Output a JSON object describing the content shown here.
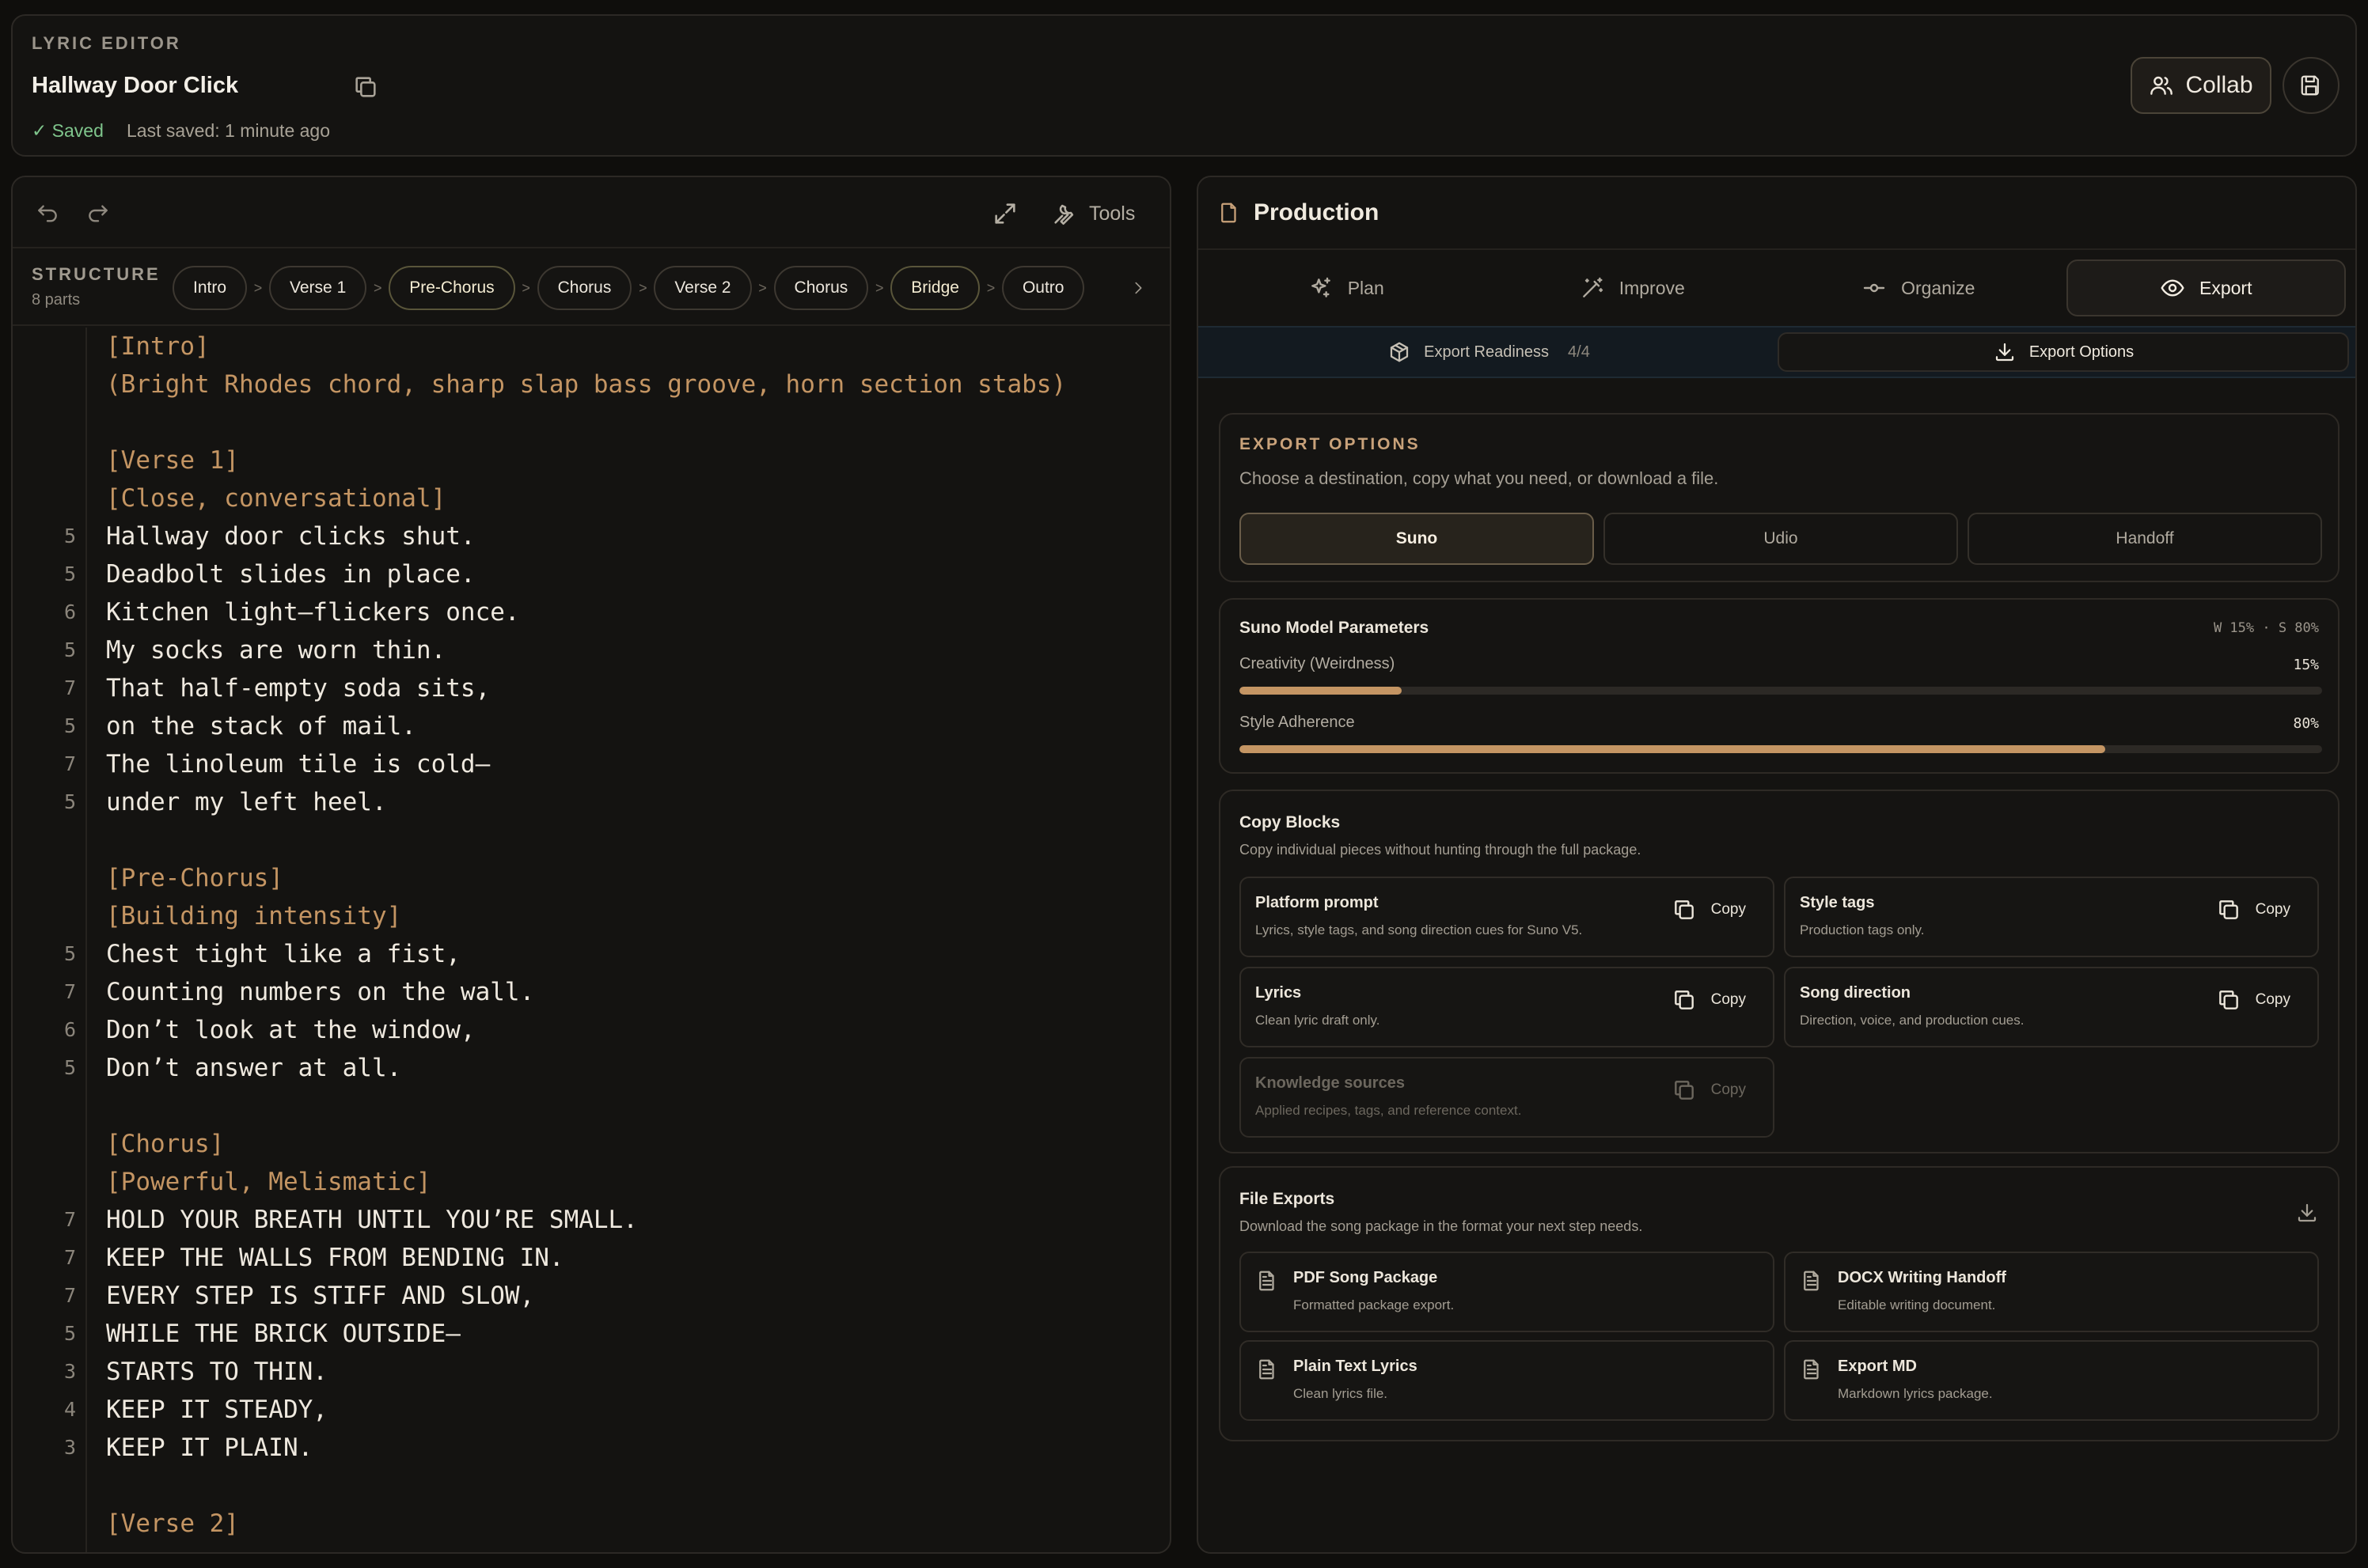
{
  "header": {
    "kicker": "LYRIC EDITOR",
    "title": "Hallway Door Click",
    "saved": "✓ Saved",
    "last_saved": "Last saved: 1 minute ago",
    "collab_label": "Collab"
  },
  "editor": {
    "tools_label": "Tools",
    "structure_label": "STRUCTURE",
    "structure_parts": "8 parts",
    "structure_chips": [
      "Intro",
      "Verse 1",
      "Pre-Chorus",
      "Chorus",
      "Verse 2",
      "Chorus",
      "Bridge",
      "Outro"
    ],
    "lines": [
      {
        "n": "",
        "text": "[Intro]",
        "tag": true
      },
      {
        "n": "",
        "text": "(Bright Rhodes chord, sharp slap bass groove, horn section stabs)",
        "tag": true
      },
      {
        "n": "",
        "text": "",
        "tag": false
      },
      {
        "n": "",
        "text": "[Verse 1]",
        "tag": true
      },
      {
        "n": "",
        "text": "[Close, conversational]",
        "tag": true
      },
      {
        "n": "5",
        "text": "Hallway door clicks shut.",
        "tag": false
      },
      {
        "n": "5",
        "text": "Deadbolt slides in place.",
        "tag": false
      },
      {
        "n": "6",
        "text": "Kitchen light—flickers once.",
        "tag": false
      },
      {
        "n": "5",
        "text": "My socks are worn thin.",
        "tag": false
      },
      {
        "n": "7",
        "text": "That half-empty soda sits,",
        "tag": false
      },
      {
        "n": "5",
        "text": "on the stack of mail.",
        "tag": false
      },
      {
        "n": "7",
        "text": "The linoleum tile is cold—",
        "tag": false
      },
      {
        "n": "5",
        "text": "under my left heel.",
        "tag": false
      },
      {
        "n": "",
        "text": "",
        "tag": false
      },
      {
        "n": "",
        "text": "[Pre-Chorus]",
        "tag": true
      },
      {
        "n": "",
        "text": "[Building intensity]",
        "tag": true
      },
      {
        "n": "5",
        "text": "Chest tight like a fist,",
        "tag": false
      },
      {
        "n": "7",
        "text": "Counting numbers on the wall.",
        "tag": false
      },
      {
        "n": "6",
        "text": "Don’t look at the window,",
        "tag": false
      },
      {
        "n": "5",
        "text": "Don’t answer at all.",
        "tag": false
      },
      {
        "n": "",
        "text": "",
        "tag": false
      },
      {
        "n": "",
        "text": "[Chorus]",
        "tag": true
      },
      {
        "n": "",
        "text": "[Powerful, Melismatic]",
        "tag": true
      },
      {
        "n": "7",
        "text": "HOLD YOUR BREATH UNTIL YOU’RE SMALL.",
        "tag": false
      },
      {
        "n": "7",
        "text": "KEEP THE WALLS FROM BENDING IN.",
        "tag": false
      },
      {
        "n": "7",
        "text": "EVERY STEP IS STIFF AND SLOW,",
        "tag": false
      },
      {
        "n": "5",
        "text": "WHILE THE BRICK OUTSIDE—",
        "tag": false
      },
      {
        "n": "3",
        "text": "STARTS TO THIN.",
        "tag": false
      },
      {
        "n": "4",
        "text": "KEEP IT STEADY,",
        "tag": false
      },
      {
        "n": "3",
        "text": "KEEP IT PLAIN.",
        "tag": false
      },
      {
        "n": "",
        "text": "",
        "tag": false
      },
      {
        "n": "",
        "text": "[Verse 2]",
        "tag": true
      }
    ]
  },
  "production": {
    "title": "Production",
    "tabs": [
      "Plan",
      "Improve",
      "Organize",
      "Export"
    ],
    "active_tab": "Export",
    "sub_tabs": {
      "readiness_label": "Export Readiness",
      "readiness_count": "4/4",
      "options_label": "Export Options"
    },
    "export_options": {
      "kicker": "EXPORT OPTIONS",
      "desc": "Choose a destination, copy what you need, or download a file.",
      "destinations": [
        "Suno",
        "Udio",
        "Handoff"
      ],
      "active_destination": "Suno"
    },
    "params": {
      "title": "Suno Model Parameters",
      "badge": "W 15% · S 80%",
      "creativity_label": "Creativity (Weirdness)",
      "creativity_value": "15%",
      "creativity_fraction": 0.15,
      "style_label": "Style Adherence",
      "style_value": "80%",
      "style_fraction": 0.8
    },
    "copy_blocks": {
      "title": "Copy Blocks",
      "desc": "Copy individual pieces without hunting through the full package.",
      "copy_label": "Copy",
      "items": [
        {
          "title": "Platform prompt",
          "desc": "Lyrics, style tags, and song direction cues for Suno V5."
        },
        {
          "title": "Style tags",
          "desc": "Production tags only."
        },
        {
          "title": "Lyrics",
          "desc": "Clean lyric draft only."
        },
        {
          "title": "Song direction",
          "desc": "Direction, voice, and production cues."
        },
        {
          "title": "Knowledge sources",
          "desc": "Applied recipes, tags, and reference context."
        }
      ]
    },
    "file_exports": {
      "title": "File Exports",
      "desc": "Download the song package in the format your next step needs.",
      "items": [
        {
          "title": "PDF Song Package",
          "desc": "Formatted package export."
        },
        {
          "title": "DOCX Writing Handoff",
          "desc": "Editable writing document."
        },
        {
          "title": "Plain Text Lyrics",
          "desc": "Clean lyrics file."
        },
        {
          "title": "Export MD",
          "desc": "Markdown lyrics package."
        }
      ]
    }
  }
}
